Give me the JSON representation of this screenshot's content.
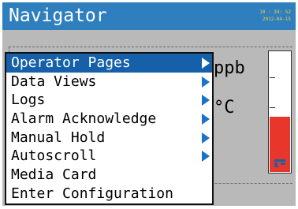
{
  "header": {
    "title": "Navigator",
    "clock_time": "10 : 34: 52",
    "clock_date": "2012-04-15"
  },
  "display": {
    "unit_1": "ppb",
    "unit_2": "°C",
    "bar_level": 0.47,
    "bar_color": "#e8372a"
  },
  "menu": {
    "items": [
      {
        "label": "Operator Pages",
        "submenu": true,
        "selected": true
      },
      {
        "label": "Data Views",
        "submenu": true
      },
      {
        "label": "Logs",
        "submenu": true
      },
      {
        "label": "Alarm Acknowledge",
        "submenu": true
      },
      {
        "label": "Manual Hold",
        "submenu": true
      },
      {
        "label": "Autoscroll",
        "submenu": true
      },
      {
        "label": "Media Card",
        "submenu": false
      },
      {
        "label": "Enter Configuration",
        "submenu": false
      }
    ]
  },
  "colors": {
    "titlebar": "#2f7fbf",
    "selection": "#1560a8",
    "screen_bg": "#b9b9b9",
    "arrow": "#1a73c8"
  },
  "icons": {
    "status": "autoscroll-icon"
  }
}
